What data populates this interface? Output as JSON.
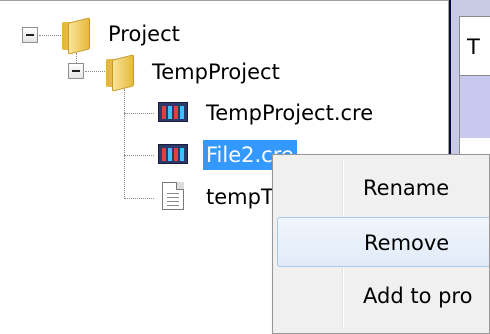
{
  "tree": {
    "root": {
      "label": "Project"
    },
    "folder": {
      "label": "TempProject"
    },
    "files": [
      {
        "label": "TempProject.cre",
        "icon": "cre-file-icon",
        "selected": false
      },
      {
        "label": "File2.cre",
        "icon": "cre-file-icon",
        "selected": true
      },
      {
        "label": "tempT",
        "icon": "document-icon",
        "selected": false
      }
    ]
  },
  "right_panel": {
    "tab_text": "T"
  },
  "context_menu": {
    "items": [
      {
        "label": "Rename",
        "hovered": false
      },
      {
        "label": "Remove",
        "hovered": true
      },
      {
        "label": "Add to pro",
        "hovered": false
      }
    ]
  },
  "colors": {
    "selection": "#3399ff",
    "menu_background": "#f0f0f0",
    "menu_hover_border": "#a8c8ee",
    "panel_accent": "#c9cbe4"
  }
}
